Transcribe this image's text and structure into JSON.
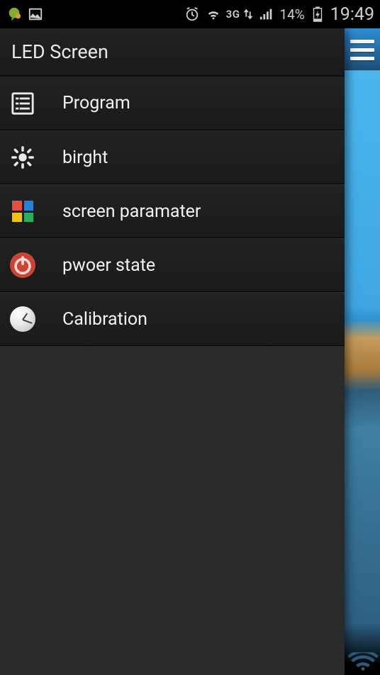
{
  "statusbar": {
    "network_type": "3G",
    "battery_percent": "14%",
    "time": "19:49"
  },
  "drawer": {
    "title": "LED Screen",
    "items": [
      {
        "label": "Program"
      },
      {
        "label": "birght"
      },
      {
        "label": "screen paramater"
      },
      {
        "label": "pwoer state"
      },
      {
        "label": "Calibration"
      }
    ]
  }
}
